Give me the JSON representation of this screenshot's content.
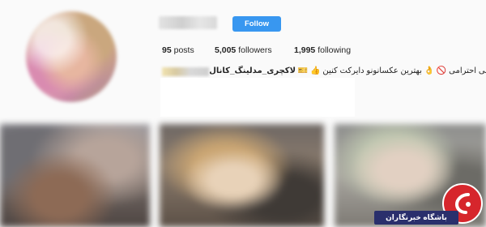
{
  "profile": {
    "username": "",
    "follow_label": "Follow",
    "stats": {
      "posts_count": "95",
      "posts_label": "posts",
      "followers_count": "5,005",
      "followers_label": "followers",
      "following_count": "1,995",
      "following_label": "following"
    },
    "bio": {
      "bold_text": "لاکچری_مدلینگ_کانال",
      "text": "بهترین عکسانونو دایرکت کنین",
      "tail_text": "بی احترامی"
    }
  },
  "watermark": {
    "text": "باشگاه خبرنگاران"
  },
  "colors": {
    "follow_button": "#3897f0",
    "watermark_red": "#d6262c",
    "watermark_navy": "#2a2f6c"
  }
}
